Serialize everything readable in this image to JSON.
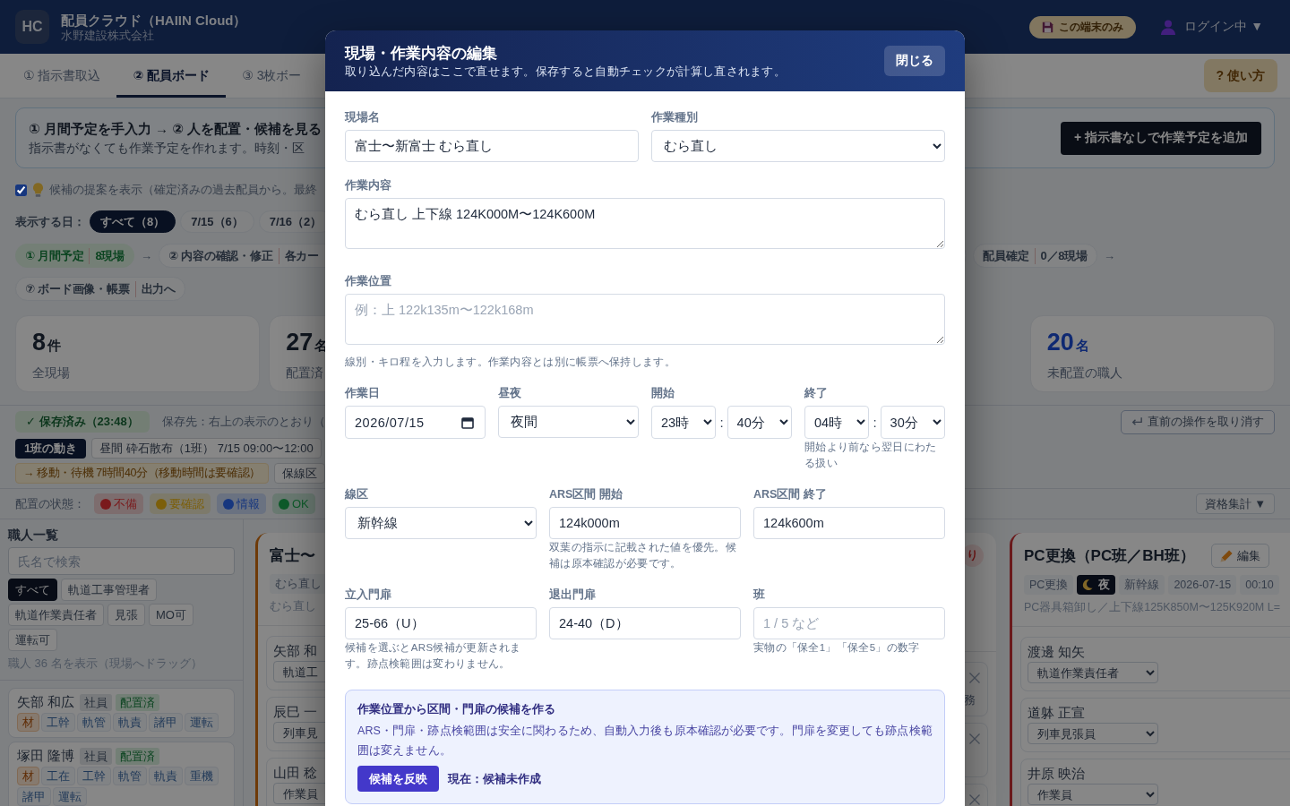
{
  "app_header": {
    "logo": "HC",
    "title": "配員クラウド（HAIIN Cloud）",
    "company": "水野建設株式会社",
    "storage_button": "この端末のみ",
    "user_menu": "ログイン中 ▼"
  },
  "nav_tabs": [
    {
      "label": "① 指示書取込",
      "selected": false
    },
    {
      "label": "② 配員ボード",
      "selected": true
    },
    {
      "label": "③ 3枚ボー",
      "selected": false
    }
  ],
  "help_button": "? 使い方",
  "intro_panel": {
    "title": "① 月間予定を手入力 → ② 人を配置・候補を見る",
    "text": "指示書がなくても作業予定を作れます。時刻・区",
    "add_button": "+ 指示書なしで作業予定を追加"
  },
  "suggestions_toggle": {
    "label": "候補の提案を表示（確定済みの過去配員から。最終",
    "checked": true
  },
  "day_filter": {
    "label": "表示する日：",
    "options": [
      {
        "label": "すべて（8）",
        "selected": true
      },
      {
        "label": "7/15（6）",
        "selected": false
      },
      {
        "label": "7/16（2）",
        "selected": false
      }
    ]
  },
  "workflow": [
    {
      "steps": [
        {
          "label": "① 月間予定",
          "count": "8現場",
          "done": true,
          "next": "→"
        },
        {
          "label": "② 内容の確認・修正",
          "count": "各カー",
          "done": false
        },
        {
          "label": "配員確定",
          "count": "0／8現場",
          "done": false,
          "next": "→"
        }
      ]
    },
    {
      "steps": [
        {
          "label": "⑦ ボード画像・帳票",
          "count": "出力へ",
          "done": false
        }
      ]
    }
  ],
  "stats": [
    {
      "value": "8",
      "unit": "件",
      "label": "全現場",
      "highlight": false
    },
    {
      "value": "27",
      "unit": "名",
      "label": "配置済",
      "highlight": false
    },
    {
      "value": "20",
      "unit": "名",
      "label": "未配置の職人",
      "highlight": true
    }
  ],
  "save_status": {
    "badge": "✓ 保存済み（23:48）",
    "location": "保存先：右上の表示のとおり（",
    "undo_button": "直前の操作を取り消す"
  },
  "team_moves": {
    "label": "1班の動き",
    "lines": [
      {
        "chips": [
          {
            "kind": "work",
            "text": "昼間 砕石散布（1班） 7/15 09:00〜12:00"
          }
        ]
      },
      {
        "chips": [
          {
            "kind": "move",
            "text": "→ 移動・待機 7時間40分（移動時間は要確認）"
          },
          {
            "kind": "work",
            "text": "保線区"
          }
        ]
      }
    ]
  },
  "status_legend": {
    "label": "配置の状態：",
    "items": [
      {
        "label": "不備",
        "color": "#7a1a1c"
      },
      {
        "label": "要確認",
        "color": "#7c5f0a"
      },
      {
        "label": "情報",
        "color": "#17377f"
      },
      {
        "label": "OK",
        "color": "#0e5a2a"
      }
    ],
    "summary_button": "資格集計 ▼"
  },
  "worker_panel": {
    "title": "職人一覧",
    "search": {
      "placeholder": "氏名で検索"
    },
    "filters": [
      {
        "label": "すべて",
        "selected": true
      },
      {
        "label": "軌道工事管理者",
        "selected": false
      },
      {
        "label": "軌道作業責任者",
        "selected": false
      },
      {
        "label": "見張",
        "selected": false
      },
      {
        "label": "MO可",
        "selected": false
      },
      {
        "label": "運転可",
        "selected": false
      }
    ],
    "count_text": "職人 36 名を表示（現場へドラッグ）",
    "workers": [
      {
        "name": "矢部 和広",
        "tags": [
          {
            "kind": "employment",
            "label": "社員"
          },
          {
            "kind": "assigned",
            "label": "配置済"
          }
        ],
        "quals": [
          {
            "kind": "material",
            "label": "材"
          },
          {
            "kind": "license",
            "label": "工幹"
          },
          {
            "kind": "license",
            "label": "軌管"
          },
          {
            "kind": "license",
            "label": "軌責"
          },
          {
            "kind": "license",
            "label": "諸甲"
          },
          {
            "kind": "license",
            "label": "運転"
          }
        ]
      },
      {
        "name": "塚田 隆博",
        "tags": [
          {
            "kind": "employment",
            "label": "社員"
          },
          {
            "kind": "assigned",
            "label": "配置済"
          }
        ],
        "quals": [
          {
            "kind": "material",
            "label": "材"
          },
          {
            "kind": "license",
            "label": "工在"
          },
          {
            "kind": "license",
            "label": "工幹"
          },
          {
            "kind": "license",
            "label": "軌管"
          },
          {
            "kind": "license",
            "label": "軌責"
          },
          {
            "kind": "license",
            "label": "重機"
          },
          {
            "kind": "license",
            "label": "諸甲"
          },
          {
            "kind": "license",
            "label": "運転"
          }
        ]
      }
    ]
  },
  "board": {
    "sites": [
      {
        "title": "富士〜",
        "color": "#6e3a08",
        "tags": [
          {
            "kind": "plain",
            "label": "むら直し"
          }
        ],
        "description": "むら直し",
        "workers": [
          {
            "name": "矢部 和",
            "role": "軌道工"
          },
          {
            "name": "辰巳 一",
            "role": "列車見"
          },
          {
            "name": "山田 稔",
            "role": "作業員"
          }
        ]
      },
      {
        "badge": "り",
        "workers": [
          {
            "note": "務",
            "removable": true
          },
          {
            "removable": true
          },
          {
            "removable": true
          }
        ]
      },
      {
        "title": "PC更換（PC班／BH班）",
        "color": "#6b1a1c",
        "edit_button": "編集",
        "tags": [
          {
            "kind": "plain",
            "label": "PC更換"
          },
          {
            "kind": "night",
            "label": "夜"
          },
          {
            "kind": "plain",
            "label": "新幹線"
          },
          {
            "kind": "plain",
            "label": "2026-07-15"
          },
          {
            "kind": "plain",
            "label": "00:10"
          }
        ],
        "description": "PC器具箱卸し／上下線125K850M〜125K920M L=",
        "workers": [
          {
            "name": "渡邊 知矢",
            "role": "軌道作業責任者"
          },
          {
            "name": "道躰 正宣",
            "role": "列車見張員"
          },
          {
            "name": "井原 映治",
            "role": "作業員"
          }
        ]
      }
    ]
  },
  "edit_dialog": {
    "title": "現場・作業内容の編集",
    "subtitle": "取り込んだ内容はここで直せます。保存すると自動チェックが計算し直されます。",
    "close_button": "閉じる",
    "field_rows": [
      {
        "fields": [
          {
            "kind": "text",
            "label": "現場名",
            "value": "富士〜新富士 むら直し"
          },
          {
            "kind": "select",
            "label": "作業種別",
            "value": "むら直し"
          }
        ]
      },
      {
        "fields": [
          {
            "kind": "textarea",
            "label": "作業内容",
            "value": "むら直し 上下線 124K000M〜124K600M"
          }
        ]
      },
      {
        "fields": [
          {
            "kind": "textarea",
            "label": "作業位置",
            "placeholder": "例：上 122k135m〜122k168m",
            "hint": "線別・キロ程を入力します。作業内容とは別に帳票へ保持します。"
          }
        ]
      },
      {
        "fields": [
          {
            "kind": "date",
            "label": "作業日",
            "value": "2026/07/15"
          },
          {
            "kind": "select",
            "label": "昼夜",
            "value": "夜間"
          },
          {
            "kind": "time",
            "label": "開始",
            "hour": "23時",
            "separator": ":",
            "minute": "40分"
          },
          {
            "kind": "time",
            "label": "終了",
            "hour": "04時",
            "separator": ":",
            "minute": "30分",
            "hint": "開始より前なら翌日にわたる扱い"
          }
        ]
      },
      {
        "fields": [
          {
            "kind": "select",
            "label": "線区",
            "value": "新幹線"
          },
          {
            "kind": "text",
            "label": "ARS区間 開始",
            "value": "124k000m",
            "hint": "双葉の指示に記載された値を優先。候補は原本確認が必要です。"
          },
          {
            "kind": "text",
            "label": "ARS区間 終了",
            "value": "124k600m"
          }
        ]
      },
      {
        "fields": [
          {
            "kind": "text",
            "label": "立入門扉",
            "value": "25-66（U）",
            "hint": "候補を選ぶとARS候補が更新されます。跡点検範囲は変わりません。"
          },
          {
            "kind": "text",
            "label": "退出門扉",
            "value": "24-40（D）"
          },
          {
            "kind": "text",
            "label": "班",
            "placeholder": "1 / 5 など",
            "hint": "実物の「保全1」「保全5」の数字"
          }
        ]
      }
    ],
    "candidate_box": {
      "title": "作業位置から区間・門扉の候補を作る",
      "text": "ARS・門扉・跡点検範囲は安全に関わるため、自動入力後も原本確認が必要です。門扉を変更しても跡点検範囲は変えません。",
      "apply_button": "候補を反映",
      "status": "現在：候補未作成"
    }
  }
}
